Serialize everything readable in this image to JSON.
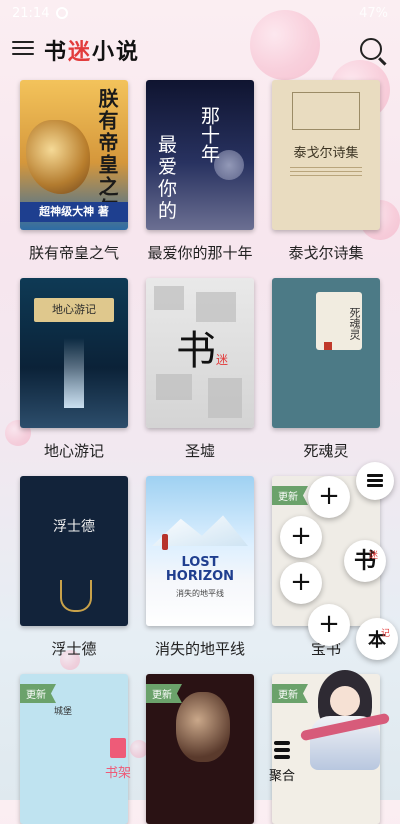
{
  "status_bar": {
    "time": "21:14",
    "right": "47%"
  },
  "toolbar": {
    "app_name_part1": "书",
    "app_name_part2": "迷",
    "app_name_part3": "小说"
  },
  "books": [
    {
      "title": "朕有帝皇之气",
      "cover_title": "朕有帝皇之气",
      "cover_author": "超神级大神 著"
    },
    {
      "title": "最爱你的那十年",
      "cover_title_a": "最爱你的",
      "cover_title_b": "那十年"
    },
    {
      "title": "泰戈尔诗集",
      "cover_title": "泰戈尔诗集"
    },
    {
      "title": "地心游记",
      "cover_title": "地心游记"
    },
    {
      "title": "圣墟",
      "cover_mark": "书",
      "cover_mark_sub": "迷"
    },
    {
      "title": "死魂灵",
      "cover_title": "死魂灵"
    },
    {
      "title": "浮士德",
      "cover_title": "浮士德"
    },
    {
      "title": "消失的地平线",
      "cover_title": "LOST HORIZON",
      "cover_subtitle": "消失的地平线"
    },
    {
      "title": "宝书",
      "badge": "更新"
    },
    {
      "title": "",
      "badge": "更新",
      "cover_title": "城堡"
    },
    {
      "title": "",
      "badge": "更新"
    },
    {
      "title": "",
      "badge": "更新"
    }
  ],
  "fab_menu": {
    "plus": "+",
    "char1": "书",
    "char1_small": "迷",
    "char2": "本",
    "char2_small": "记"
  },
  "bottom_nav": {
    "shelf": "书架",
    "aggregate": "聚合"
  },
  "colors": {
    "accent": "#ee5b78",
    "brand_red": "#e23c3c"
  }
}
